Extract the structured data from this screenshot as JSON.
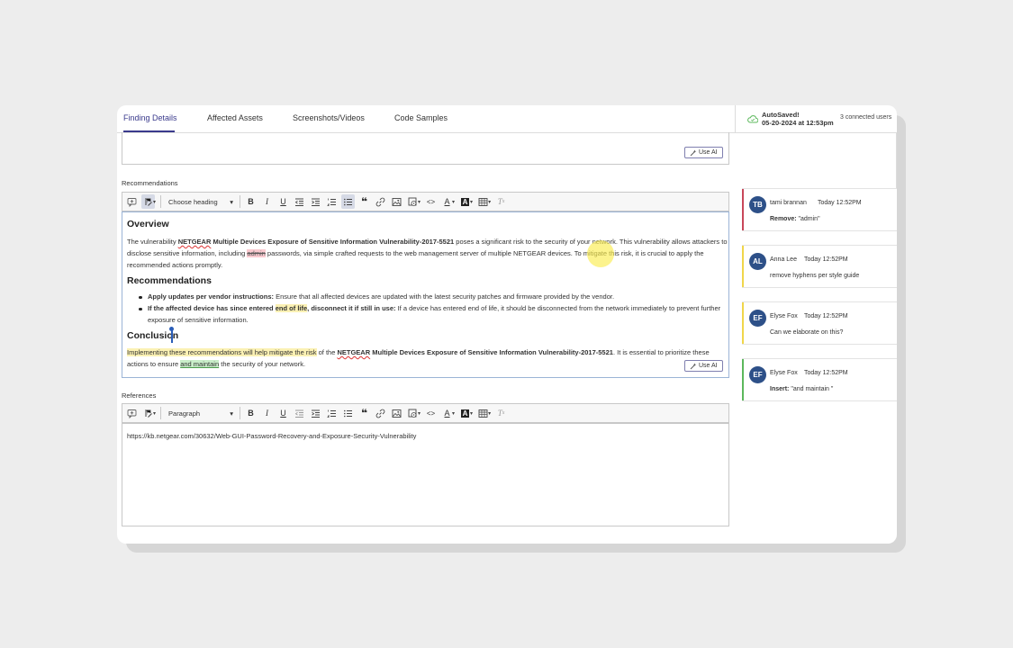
{
  "tabs": [
    {
      "label": "Finding Details",
      "active": true
    },
    {
      "label": "Affected Assets",
      "active": false
    },
    {
      "label": "Screenshots/Videos",
      "active": false
    },
    {
      "label": "Code Samples",
      "active": false
    }
  ],
  "status": {
    "autosave_line1": "AutoSaved!",
    "autosave_line2": "05-20-2024 at 12:53pm",
    "connected_users": "3 connected users"
  },
  "use_ai_label": "Use AI",
  "recommendations": {
    "label": "Recommendations",
    "heading_select": "Choose heading",
    "overview_heading": "Overview",
    "overview_p1_a": "The vulnerability ",
    "overview_p1_b": "NETGEAR",
    "overview_p1_c": " Multiple Devices Exposure of Sensitive Information Vulnerability-2017-5521",
    "overview_p1_d": " poses a significant risk to the security of your network. This vulnerability allows attackers to",
    "overview_p2_a": "disclose sensitive information, including ",
    "overview_p2_del": "admin",
    "overview_p2_b": " passwords, via simple crafted requests to the web management server of multiple NETGEAR devices. To mitigate this risk, it is crucial to apply the",
    "overview_p3": "recommended actions promptly.",
    "rec_heading": "Recommendations",
    "bullet1_bold": "Apply updates per vendor instructions:",
    "bullet1_text": " Ensure that all affected devices are updated with the latest security patches and firmware provided by the vendor.",
    "bullet2_bold_a": "If the affected device has since entered ",
    "bullet2_bold_hl": "end of life",
    "bullet2_bold_b": ", disconnect it if still in use:",
    "bullet2_text": " If a device has entered end of life, it should be disconnected from the network immediately to prevent further",
    "bullet2_text2": "exposure of sensitive information.",
    "conclusion_heading": "Conclusion",
    "concl_hl": "Implementing these recommendations will help mitigate the risk",
    "concl_a": " of the ",
    "concl_b": "NETGEAR",
    "concl_c": " Multiple Devices Exposure of Sensitive Information Vulnerability-2017-5521",
    "concl_d": ". It is essential to prioritize these",
    "concl2_a": "actions to ensure ",
    "concl2_ins": "and maintain",
    "concl2_b": " the security of your network."
  },
  "references": {
    "label": "References",
    "heading_select": "Paragraph",
    "url": "https://kb.netgear.com/30632/Web-GUI-Password-Recovery-and-Exposure-Security-Vulnerability"
  },
  "comments": [
    {
      "initials": "TB",
      "name": "tami brannan",
      "time": "Today 12:52PM",
      "body_label": "Remove:",
      "body": " \"admin\"",
      "bar_color": "#c8475a"
    },
    {
      "initials": "AL",
      "name": "Anna Lee",
      "time": "Today 12:52PM",
      "body_label": "",
      "body": "remove hyphens per style guide",
      "bar_color": "#f0d64a"
    },
    {
      "initials": "EF",
      "name": "Elyse Fox",
      "time": "Today 12:52PM",
      "body_label": "",
      "body": "Can we elaborate on this?",
      "bar_color": "#f0d64a"
    },
    {
      "initials": "EF",
      "name": "Elyse Fox",
      "time": "Today 12:52PM",
      "body_label": "Insert:",
      "body": " \"and maintain \"",
      "bar_color": "#5cb85c"
    }
  ],
  "colors": {
    "accent": "#3a3a8c",
    "avatar": "#2d5088"
  }
}
